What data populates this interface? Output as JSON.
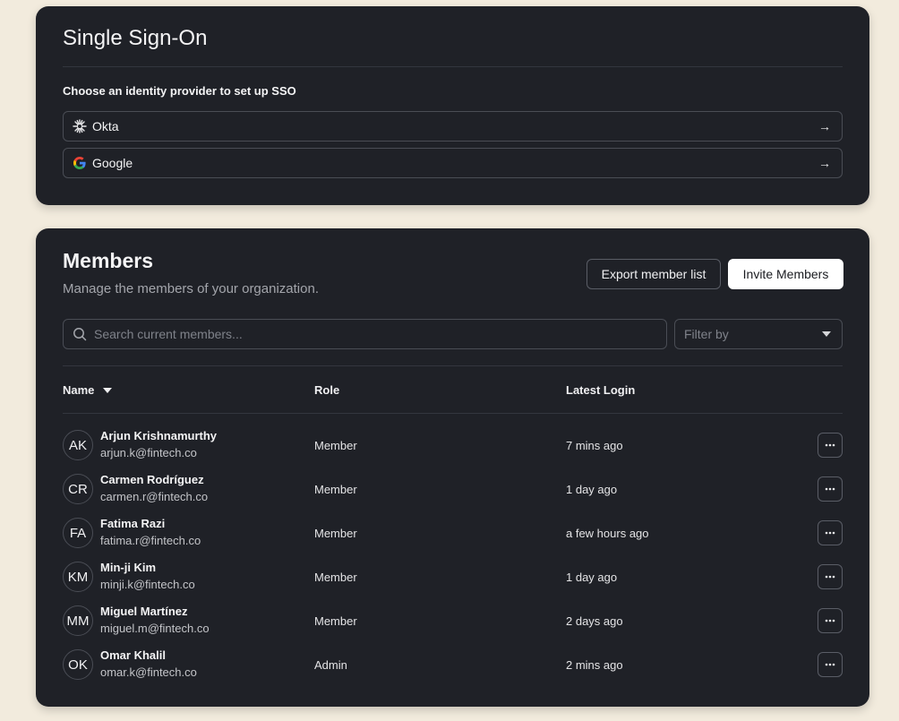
{
  "sso": {
    "title": "Single Sign-On",
    "subtitle": "Choose an identity provider to set up SSO",
    "providers": [
      {
        "label": "Okta",
        "icon": "okta-icon"
      },
      {
        "label": "Google",
        "icon": "google-icon"
      }
    ]
  },
  "members": {
    "title": "Members",
    "subtitle": "Manage the members of your organization.",
    "export_label": "Export member list",
    "invite_label": "Invite Members",
    "search_placeholder": "Search current members...",
    "filter_placeholder": "Filter by",
    "columns": {
      "name": "Name",
      "role": "Role",
      "login": "Latest Login"
    },
    "rows": [
      {
        "initials": "AK",
        "name": "Arjun Krishnamurthy",
        "email": "arjun.k@fintech.co",
        "role": "Member",
        "login": "7 mins ago"
      },
      {
        "initials": "CR",
        "name": "Carmen Rodríguez",
        "email": "carmen.r@fintech.co",
        "role": "Member",
        "login": "1 day ago"
      },
      {
        "initials": "FA",
        "name": "Fatima Razi",
        "email": "fatima.r@fintech.co",
        "role": "Member",
        "login": "a few hours ago"
      },
      {
        "initials": "KM",
        "name": "Min-ji Kim",
        "email": "minji.k@fintech.co",
        "role": "Member",
        "login": "1 day ago"
      },
      {
        "initials": "MM",
        "name": "Miguel Martínez",
        "email": "miguel.m@fintech.co",
        "role": "Member",
        "login": "2 days ago"
      },
      {
        "initials": "OK",
        "name": "Omar Khalil",
        "email": "omar.k@fintech.co",
        "role": "Admin",
        "login": "2 mins ago"
      }
    ]
  },
  "colors": {
    "page_bg": "#f2ebdd",
    "card_bg": "#1f2127",
    "border": "#4a4d55",
    "accent_button": "#ffffff"
  }
}
